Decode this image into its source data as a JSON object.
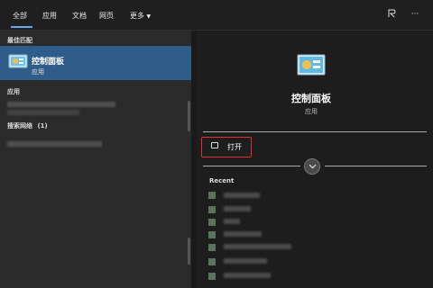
{
  "tabs": [
    "全部",
    "应用",
    "文档",
    "网页",
    "更多"
  ],
  "top_icons": {
    "feedback": "person-feedback-icon",
    "more": "more-icon",
    "more_text": "···"
  },
  "left": {
    "best_match_heading": "最佳匹配",
    "best_match": {
      "title": "控制面板",
      "subtitle": "应用"
    },
    "apps_heading": "应用",
    "web_heading": "搜索网络",
    "web_count": "(1)"
  },
  "right": {
    "app_title": "控制面板",
    "app_subtitle": "应用",
    "open_label": "打开",
    "recent_heading": "Recent"
  },
  "colors": {
    "accent": "#2f5d8a",
    "highlight_border": "#e0302f",
    "tab_underline": "#6aa7e8"
  }
}
